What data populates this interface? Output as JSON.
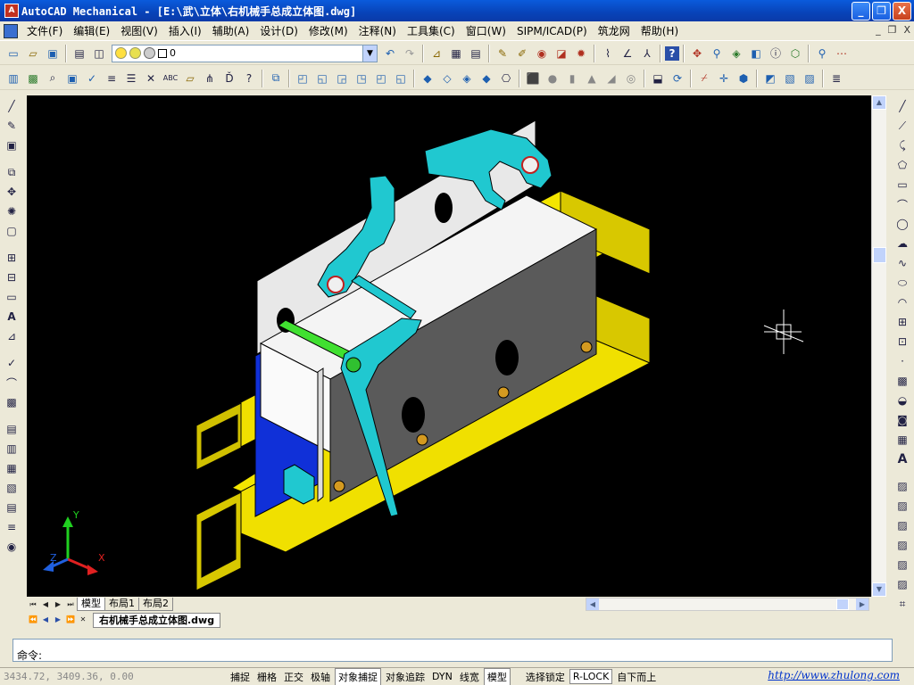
{
  "window": {
    "title": "AutoCAD Mechanical - [E:\\武\\立体\\右机械手总成立体图.dwg]",
    "controls": [
      "_",
      "❐",
      "X"
    ]
  },
  "menu": [
    "文件(F)",
    "编辑(E)",
    "视图(V)",
    "插入(I)",
    "辅助(A)",
    "设计(D)",
    "修改(M)",
    "注释(N)",
    "工具集(C)",
    "窗口(W)",
    "SIPM/ICAD(P)",
    "筑龙网",
    "帮助(H)"
  ],
  "mdi_controls": [
    "_",
    "❐",
    "X"
  ],
  "layer": {
    "value": "0"
  },
  "layout_tabs": [
    "模型",
    "布局1",
    "布局2"
  ],
  "document_tab": "右机械手总成立体图.dwg",
  "command": {
    "prompt": "命令:"
  },
  "status": {
    "coordinates": "3434.72, 3409.36, 0.00",
    "toggles": [
      {
        "label": "捕捉",
        "on": false
      },
      {
        "label": "栅格",
        "on": false
      },
      {
        "label": "正交",
        "on": false
      },
      {
        "label": "极轴",
        "on": false
      },
      {
        "label": "对象捕捉",
        "on": true
      },
      {
        "label": "对象追踪",
        "on": false
      },
      {
        "label": "DYN",
        "on": false
      },
      {
        "label": "线宽",
        "on": false
      },
      {
        "label": "模型",
        "on": true
      },
      {
        "label": "选择锁定",
        "on": false
      },
      {
        "label": "R-LOCK",
        "on": true
      },
      {
        "label": "自下而上",
        "on": false
      }
    ],
    "url": "http://www.zhulong.com"
  },
  "ucs": {
    "x": "X",
    "y": "Y",
    "z": "Z"
  },
  "colors": {
    "titlebar": "#0a4fd0",
    "model_yellow": "#f0e000",
    "plate_gray": "#5a5a5a",
    "arm_cyan": "#20c8d0",
    "pin_green": "#40e030",
    "bracket_blue": "#1030d8"
  }
}
